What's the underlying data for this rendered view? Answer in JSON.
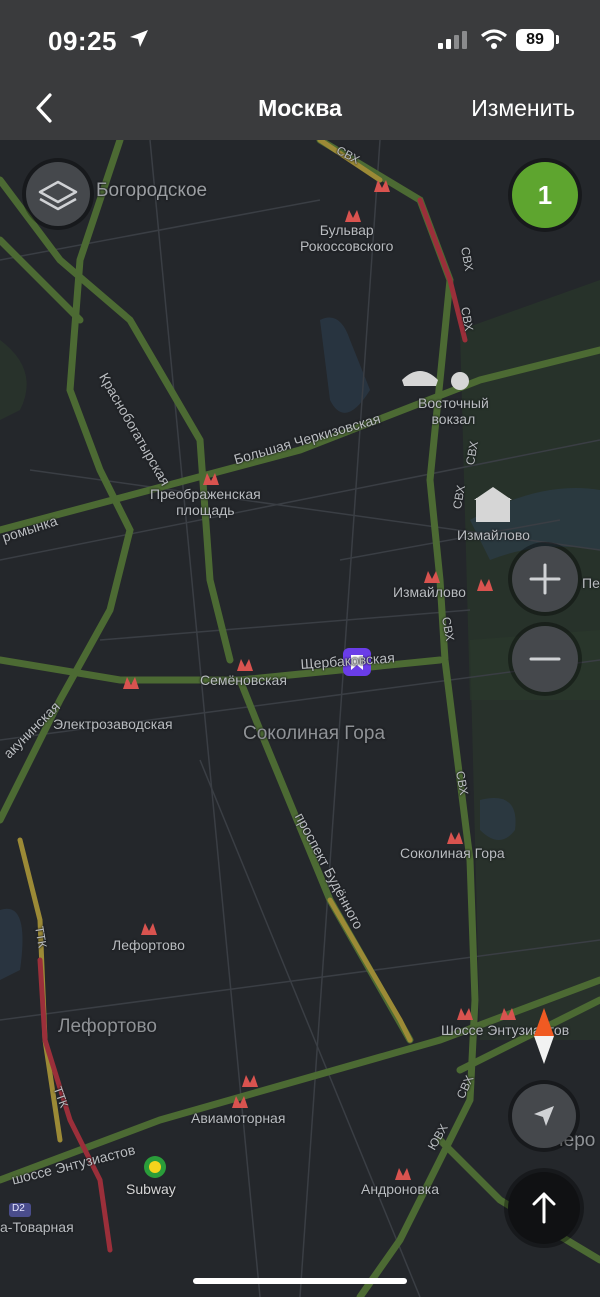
{
  "status_bar": {
    "time": "09:25",
    "battery": "89"
  },
  "header": {
    "back_label": "",
    "title": "Москва",
    "edit_label": "Изменить"
  },
  "map": {
    "traffic_level": "1",
    "labels": {
      "bogorodskoe": "Богородское",
      "bulvar_rokossovskogo": "Бульвар\nРокоссовского",
      "vostochny_vokzal": "Восточный\nвокзал",
      "krasnobogatyrskaya": "Краснобогатырская",
      "bolshaya_cherkizovskaya": "Большая Черкизовская",
      "preobrazhenskaya": "Преображенская\nплощадь",
      "izmailovo_park": "Измайлово",
      "izmailovo_metro": "Измайлово",
      "romynka": "ромынка",
      "semenovskaya": "Семёновская",
      "shcherbakovskaya": "Щербаковская",
      "elektrozavodskaya": "Электрозаводская",
      "bakuninskaya": "акунинская",
      "sokolinaya_gora_district": "Соколиная Гора",
      "sokolinaya_gora_station": "Соколиная Гора",
      "prospekt_budennogo": "проспект Будённого",
      "lefortovo_station": "Лефортово",
      "lefortovo_district": "Лефортово",
      "shosse_entuziastov_station": "Шоссе Энтузиастов",
      "aviamotornaya": "Авиамоторная",
      "shosse_entuziastov_street": "шоссе Энтузиастов",
      "subway": "Subway",
      "andronovka": "Андроновка",
      "tovarnaya": "а-Товарная",
      "d2": "D2",
      "pe": "Пе",
      "pero": "Перо",
      "svh": "СВХ",
      "ttk": "ТТК",
      "yuvh": "ЮВХ",
      "ttk_lefortovo": "ТТК"
    }
  },
  "colors": {
    "map_bg": "#24272b",
    "road_green": "#4c6a33",
    "road_yellow": "#9c8a36",
    "road_red": "#9b2f3a",
    "metro_red": "#d9534f",
    "traffic_green": "#5ea52f",
    "poi_purple": "#6a3de8",
    "compass_orange": "#f05a22"
  }
}
